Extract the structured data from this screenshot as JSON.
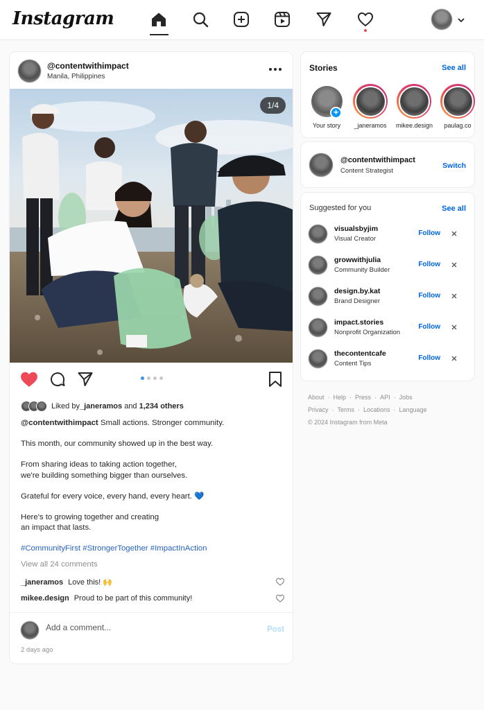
{
  "app": {
    "logo": "Instagram",
    "accent": "#0095f6",
    "like_color": "#ed4956",
    "nav_icons": [
      "home-icon",
      "search-icon",
      "create-icon",
      "reels-icon",
      "direct-icon",
      "heart-icon"
    ]
  },
  "post": {
    "username": "@contentwithimpact",
    "location": "Manila, Philippines",
    "image_counter": "1/4",
    "carousel_dots": 4,
    "active_dot": 1,
    "liked_by_prefix": "Liked by ",
    "liked_by_user": "_janeramos",
    "liked_by_connector": " and ",
    "liked_by_others": "1,234 others",
    "caption_user": "@contentwithimpact",
    "caption_first": " Small actions. Stronger community.",
    "caption_p2": "This month, our community showed up in the best way.",
    "caption_p3": "From sharing ideas to taking action together,\nwe're building something bigger than ourselves.",
    "caption_p4": "Grateful for every voice, every hand, every heart. 💙",
    "caption_p5": "Here's to growing together and creating\nan impact that lasts.",
    "hashtags": "#CommunityFirst #StrongerTogether #ImpactInAction",
    "view_all_comments": "View all 24 comments",
    "comments": [
      {
        "user": "_janeramos",
        "text": "Love this! 🙌"
      },
      {
        "user": "mikee.design",
        "text": "Proud to be part of this community!"
      }
    ],
    "add_comment_placeholder": "Add a comment...",
    "post_button": "Post",
    "time_ago": "2 days ago"
  },
  "stories": {
    "title": "Stories",
    "see_all": "See all",
    "items": [
      {
        "name": "Your story"
      },
      {
        "name": "_janeramos"
      },
      {
        "name": "mikee.design"
      },
      {
        "name": "paulag.co"
      }
    ]
  },
  "account": {
    "username": "@contentwithimpact",
    "role": "Content Strategist",
    "switch_label": "Switch"
  },
  "suggested": {
    "title": "Suggested for you",
    "see_all": "See all",
    "follow_label": "Follow",
    "items": [
      {
        "name": "visualsbyjim",
        "sub": "Visual Creator"
      },
      {
        "name": "growwithjulia",
        "sub": "Community Builder"
      },
      {
        "name": "design.by.kat",
        "sub": "Brand Designer"
      },
      {
        "name": "impact.stories",
        "sub": "Nonprofit Organization"
      },
      {
        "name": "thecontentcafe",
        "sub": "Content Tips"
      }
    ]
  },
  "footer": {
    "row1": [
      "About",
      "Help",
      "Press",
      "API",
      "Jobs"
    ],
    "row2": [
      "Privacy",
      "Terms",
      "Locations",
      "Language"
    ],
    "copyright": "© 2024 Instagram from Meta"
  }
}
